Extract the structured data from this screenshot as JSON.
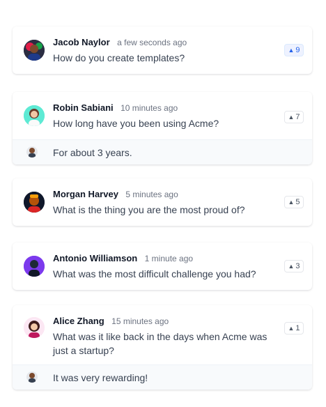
{
  "questions": [
    {
      "author": "Jacob Naylor",
      "time": "a few seconds ago",
      "text": "How do you create templates?",
      "votes": "9",
      "voted": true
    },
    {
      "author": "Robin Sabiani",
      "time": "10 minutes ago",
      "text": "How long have you been using Acme?",
      "votes": "7",
      "voted": false,
      "answer": "For about 3 years."
    },
    {
      "author": "Morgan Harvey",
      "time": "5 minutes ago",
      "text": "What is the thing you are the most proud of?",
      "votes": "5",
      "voted": false
    },
    {
      "author": "Antonio Williamson",
      "time": "1 minute ago",
      "text": "What was the most difficult challenge you had?",
      "votes": "3",
      "voted": false
    },
    {
      "author": "Alice Zhang",
      "time": "15 minutes ago",
      "text": "What was it like back in the days when Acme was just a startup?",
      "votes": "1",
      "voted": false,
      "answer": "It was very rewarding!"
    }
  ],
  "vote_icon": "▲",
  "colors": {
    "accent": "#2563eb",
    "answer_bg": "#f8fafc"
  }
}
